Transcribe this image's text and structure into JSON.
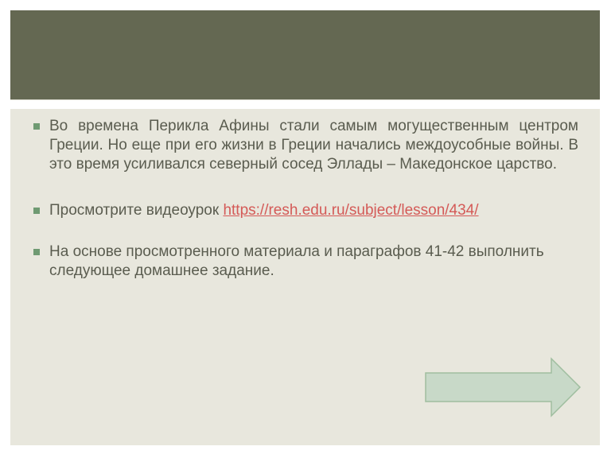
{
  "slide": {
    "header": {
      "title": "",
      "color": "#646852"
    },
    "panel_color": "#e8e7dd",
    "bullets": [
      {
        "text": "Во времена Перикла Афины стали самым могущественным центром Греции. Но еще при его жизни в Греции начались междоусобные войны. В это время усиливался северный сосед Эллады – Македонское царство."
      },
      {
        "prefix": "Просмотрите видеоурок ",
        "link": "https://resh.edu.ru/subject/lesson/434/"
      },
      {
        "text": "На основе просмотренного материала и параграфов 41-42 выполнить следующее домашнее задание."
      }
    ],
    "bullet_color": "#6f9a72",
    "link_color": "#d45a57",
    "next_arrow": {
      "icon": "right-arrow-icon",
      "fill": "#c8d9c8",
      "stroke": "#9fbe9f"
    }
  }
}
